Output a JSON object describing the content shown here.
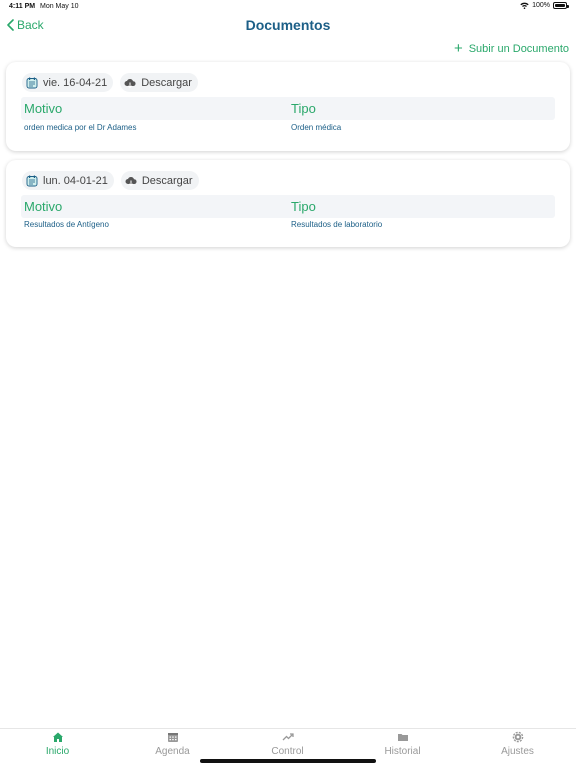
{
  "status_bar": {
    "time": "4:11 PM",
    "date": "Mon May 10",
    "battery": "100%"
  },
  "nav": {
    "back_label": "Back",
    "title": "Documentos"
  },
  "upload_label": "Subir un Documento",
  "documents": [
    {
      "date": "vie. 16-04-21",
      "download_label": "Descargar",
      "motivo_header": "Motivo",
      "tipo_header": "Tipo",
      "motivo": "orden medica por el Dr Adames",
      "tipo": "Orden médica"
    },
    {
      "date": "lun. 04-01-21",
      "download_label": "Descargar",
      "motivo_header": "Motivo",
      "tipo_header": "Tipo",
      "motivo": "Resultados de Antígeno",
      "tipo": "Resultados de laboratorio"
    }
  ],
  "tabs": [
    {
      "label": "Inicio",
      "icon": "home-icon",
      "active": true
    },
    {
      "label": "Agenda",
      "icon": "calendar-icon",
      "active": false
    },
    {
      "label": "Control",
      "icon": "trend-icon",
      "active": false
    },
    {
      "label": "Historial",
      "icon": "folder-icon",
      "active": false
    },
    {
      "label": "Ajustes",
      "icon": "gear-icon",
      "active": false
    }
  ],
  "colors": {
    "accent_green": "#2aa86b",
    "title_blue": "#1c5f87"
  }
}
